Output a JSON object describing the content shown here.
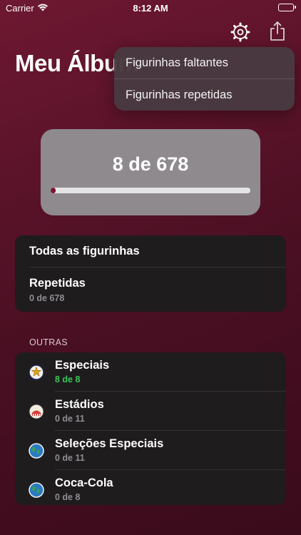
{
  "status_bar": {
    "carrier": "Carrier",
    "time": "8:12 AM"
  },
  "header": {
    "title": "Meu Álbum"
  },
  "menu": {
    "items": [
      "Figurinhas faltantes",
      "Figurinhas repetidas"
    ]
  },
  "progress": {
    "label": "8 de 678",
    "collected": 8,
    "total": 678
  },
  "main_list": {
    "all_label": "Todas as figurinhas",
    "repeated_label": "Repetidas",
    "repeated_count": "0 de 678"
  },
  "section_others": {
    "label": "OUTRAS"
  },
  "others": [
    {
      "title": "Especiais",
      "count": "8 de 8",
      "icon": "star-badge-icon"
    },
    {
      "title": "Estádios",
      "count": "0 de 11",
      "icon": "stadium-icon"
    },
    {
      "title": "Seleções Especiais",
      "count": "0 de 11",
      "icon": "globe-icon"
    },
    {
      "title": "Coca-Cola",
      "count": "0 de 8",
      "icon": "globe-icon"
    }
  ],
  "colors": {
    "accent": "#7a1530",
    "complete": "#39c55a",
    "card": "#8e8a8e"
  }
}
